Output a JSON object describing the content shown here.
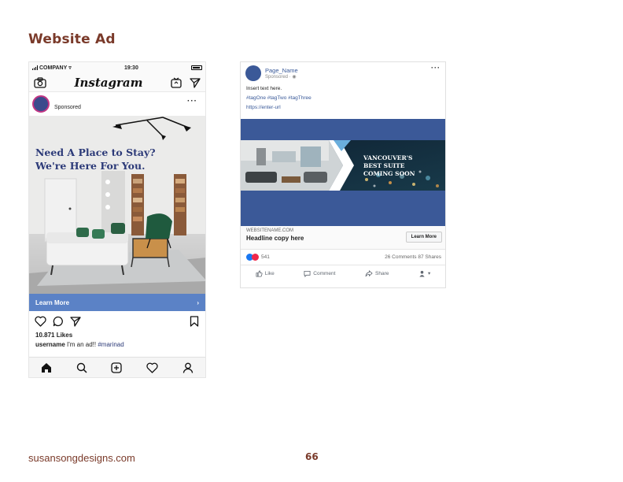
{
  "page": {
    "title": "Website Ad",
    "footer_site": "susansongdesigns.com",
    "page_number": "66"
  },
  "instagram": {
    "status": {
      "carrier": "COMPANY",
      "time": "19:30"
    },
    "logo": "Instagram",
    "sponsored": "Sponsored",
    "headline_line1": "Need A Place to Stay?",
    "headline_line2": "We're Here For You.",
    "learn_more": "Learn More",
    "likes": "10.871 Likes",
    "caption_user": "username",
    "caption_text": " I'm an ad!! ",
    "caption_tag": "#marinad",
    "brand_color": "#5b82c6",
    "headline_color": "#2c3a78",
    "icons": [
      "camera-icon",
      "igtv-icon",
      "send-icon",
      "heart-icon",
      "comment-icon",
      "share-icon",
      "bookmark-icon",
      "home-icon",
      "search-icon",
      "add-icon",
      "activity-icon",
      "profile-icon"
    ]
  },
  "facebook": {
    "page_name": "Page_Name",
    "sponsored": "Sponsored · ",
    "post_text": "Insert text here.",
    "tags": "#tagOne #tagTwo #tagThree",
    "url": "https://enter-url",
    "banner_line1": "VANCOUVER'S",
    "banner_line2": "BEST SUITE",
    "banner_line3": "COMING SOON",
    "domain": "WEBSITENAME.COM",
    "headline": "Headline copy here",
    "learn_more": "Learn More",
    "reactions": "541",
    "stats": "26 Comments  87 Shares",
    "like": "Like",
    "comment": "Comment",
    "share": "Share",
    "brand_color": "#3b5998"
  }
}
